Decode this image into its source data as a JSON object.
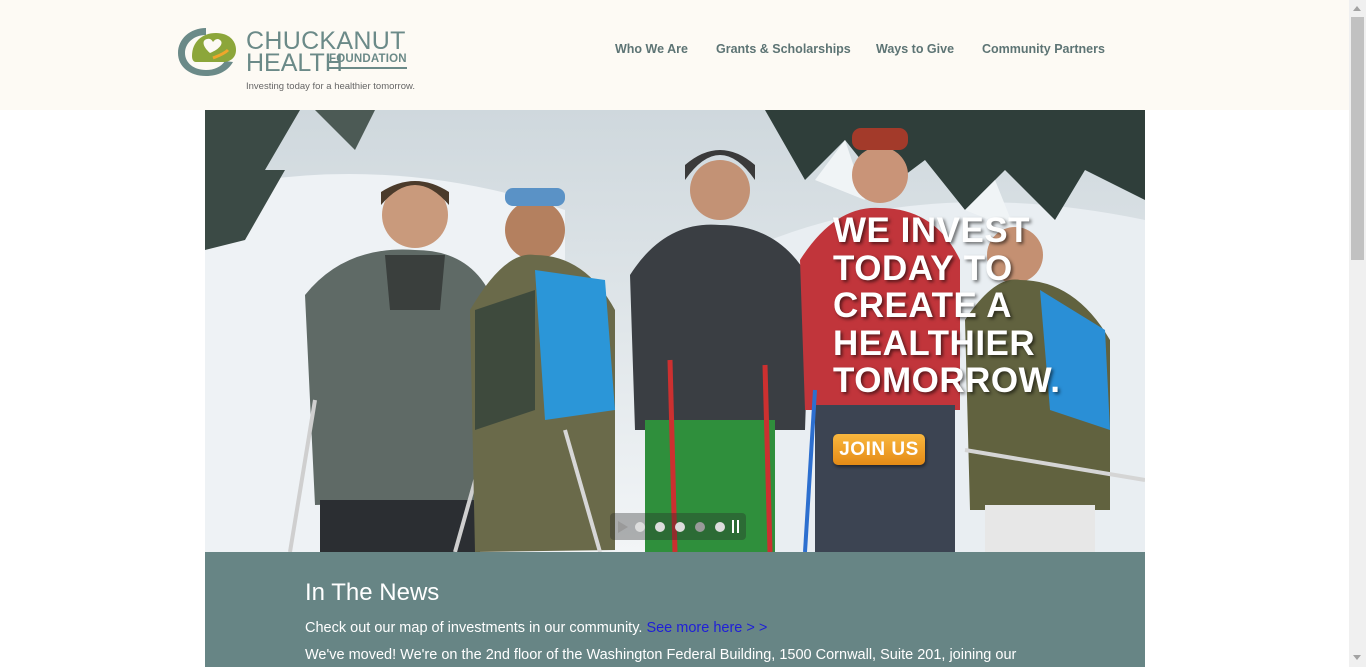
{
  "brand": {
    "name_line1": "CHUCKANUT",
    "name_line2": "HEALTH",
    "name_line3": "FOUNDATION",
    "tagline": "Investing today for a healthier tomorrow.",
    "logo_icon": "leaf-heart-icon",
    "colors": {
      "primary": "#6b8a88",
      "accent_green": "#8ca63a",
      "accent_orange": "#f0a62b"
    }
  },
  "nav": {
    "items": [
      {
        "label": "Who We Are"
      },
      {
        "label": "Grants & Scholarships"
      },
      {
        "label": "Ways to Give"
      },
      {
        "label": "Community Partners"
      }
    ]
  },
  "hero": {
    "headline": "WE INVEST\nTODAY TO\nCREATE A\nHEALTHIER\nTOMORROW.",
    "cta_label": "JOIN US",
    "image_description_icon": "photo-skiers",
    "slider": {
      "play_icon": "play-icon",
      "pause_icon": "pause-icon",
      "slide_count": 5,
      "active_index": 3
    }
  },
  "news": {
    "title": "In The News",
    "line1_text": "Check out our map of investments in our community.",
    "line1_link": "See more here > >",
    "line2_text": "We've moved! We're on the 2nd floor of the Washington Federal Building, 1500 Cornwall, Suite 201, joining our"
  }
}
